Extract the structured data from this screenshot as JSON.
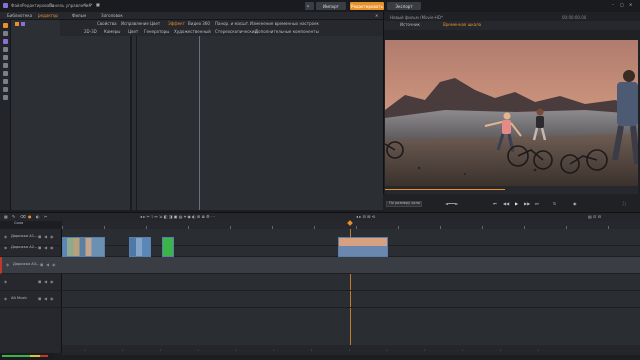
{
  "menu": [
    "Файл",
    "Редактировать",
    "Панель управления"
  ],
  "modes": {
    "import": "Импорт",
    "edit": "Редактировать",
    "export": "Экспорт"
  },
  "toptabs": [
    "Библиотека",
    "редактор",
    "Фильм",
    "Заголовок"
  ],
  "propTabs": [
    "Свойства",
    "Исправление",
    "Цвет",
    "Эффект",
    "Видео 360",
    "Панор. и масшт.",
    "Изменение временных настроек"
  ],
  "propRow": [
    "2D-3D",
    "Камеры",
    "Цвет",
    "Генераторы",
    "Художественный",
    "Стереоскопический",
    "Дополнительные компоненты"
  ],
  "preview": {
    "title": "Новый фильм (Movie-HD*",
    "tab_source": "Источник",
    "tab_timeline": "Временная шкала",
    "timecode": "00:00:00.00",
    "zoom": "По размеру окна"
  },
  "tracks": [
    {
      "name": "Дорожка А1...",
      "selected": false
    },
    {
      "name": "Дорожка А2...",
      "selected": false
    },
    {
      "name": "Дорожка А3...",
      "selected": true
    },
    {
      "name": "",
      "selected": false
    },
    {
      "name": "Alt Music",
      "selected": false
    }
  ],
  "timeline": {
    "zoom_label": "Сила"
  },
  "colors": {
    "accent": "#e8912a",
    "select": "#c1392b",
    "clip_border": "#5a7fa8",
    "green": "#3bb54a"
  }
}
